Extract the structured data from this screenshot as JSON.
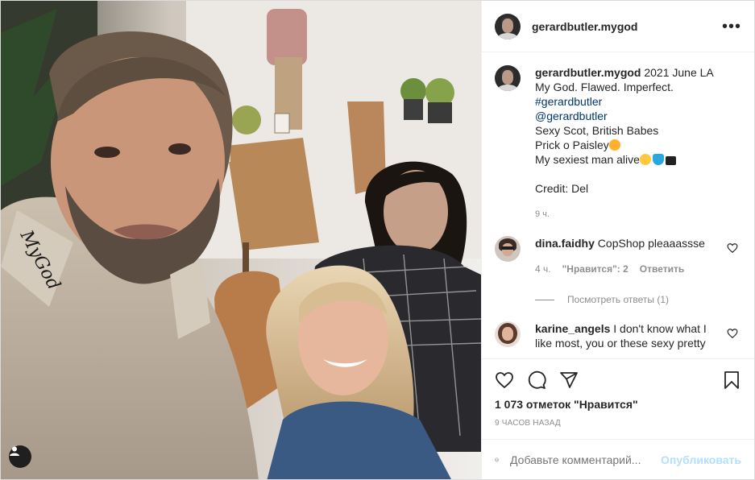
{
  "post": {
    "username": "gerardbutler.mygod",
    "more_label": "•••",
    "photo_text": "MyGod"
  },
  "caption": {
    "username": "gerardbutler.mygod",
    "first_line_rest": "2021 June LA",
    "lines": [
      "My God. Flawed. Imperfect.",
      "#gerardbutler",
      "@gerardbutler",
      "Sexy Scot, British Babes",
      "Prick o Paisley",
      "My sexiest man alive"
    ],
    "credit": "Credit: Del",
    "time": "9 ч."
  },
  "comments": [
    {
      "username": "dina.faidhy",
      "text": "CopShop pleaaassse",
      "time": "4 ч.",
      "likes": "\"Нравится\": 2",
      "reply_label": "Ответить",
      "view_replies": "Посмотреть ответы (1)"
    },
    {
      "username": "karine_angels",
      "text": "I don't know what I like most, you or these sexy pretty"
    }
  ],
  "actions": {
    "like_count": "1 073 отметок \"Нравится\"",
    "posted_ago": "9 часов назад"
  },
  "add_comment": {
    "placeholder": "Добавьте комментарий...",
    "publish": "Опубликовать"
  },
  "icons": [
    "more-icon",
    "tag-user-icon",
    "heart-icon",
    "comment-icon",
    "share-icon",
    "bookmark-icon",
    "smile-icon",
    "comment-like-icon"
  ]
}
